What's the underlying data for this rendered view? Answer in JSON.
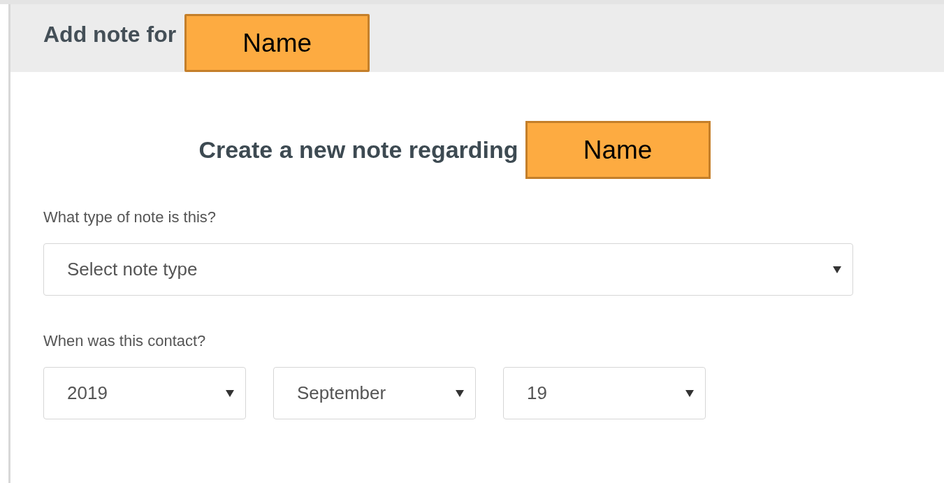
{
  "header": {
    "title": "Add note for",
    "name_tag": "Name"
  },
  "form": {
    "heading": "Create a new note regarding",
    "name_tag": "Name",
    "note_type": {
      "label": "What type of note is this?",
      "placeholder": "Select note type"
    },
    "contact_date": {
      "label": "When was this contact?",
      "selects": [
        {
          "value": "2019"
        },
        {
          "value": "September"
        },
        {
          "value": "19"
        }
      ]
    }
  }
}
